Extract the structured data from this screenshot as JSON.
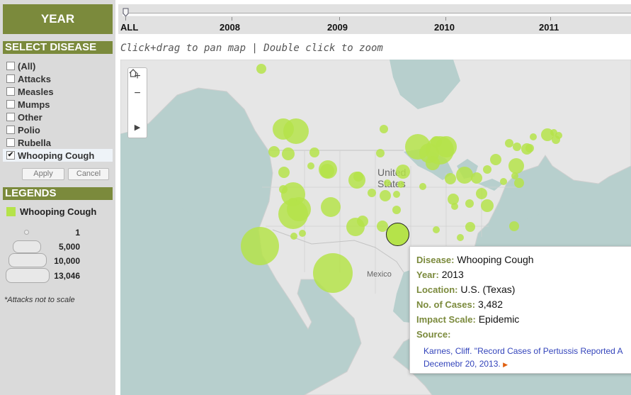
{
  "sidebar": {
    "year_title": "YEAR",
    "select_title": "SELECT DISEASE",
    "diseases": [
      {
        "label": "(All)",
        "checked": false
      },
      {
        "label": "Attacks",
        "checked": false
      },
      {
        "label": "Measles",
        "checked": false
      },
      {
        "label": "Mumps",
        "checked": false
      },
      {
        "label": "Other",
        "checked": false
      },
      {
        "label": "Polio",
        "checked": false
      },
      {
        "label": "Rubella",
        "checked": false
      },
      {
        "label": "Whooping Cough",
        "checked": true
      }
    ],
    "apply_label": "Apply",
    "cancel_label": "Cancel",
    "legends_title": "LEGENDS",
    "legend_series": "Whooping Cough",
    "legend_color": "#b5e34a",
    "size_scale": [
      "1",
      "5,000",
      "10,000",
      "13,046"
    ],
    "note": "*Attacks not to scale"
  },
  "timeline": {
    "labels": [
      "ALL",
      "2008",
      "2009",
      "2010",
      "2011"
    ]
  },
  "hint": "Click+drag to pan map | Double click to zoom",
  "map": {
    "labels": {
      "us": "United States",
      "us_line1": "United",
      "us_line2": "States",
      "mexico": "Mexico"
    },
    "zoom_controls": [
      "+",
      "−",
      "home",
      "▶"
    ],
    "bubble_color": "#b5e34a"
  },
  "tooltip": {
    "disease_key": "Disease:",
    "disease": "Whooping Cough",
    "year_key": "Year:",
    "year": "2013",
    "location_key": "Location:",
    "location": "U.S. (Texas)",
    "cases_key": "No. of Cases:",
    "cases": "3,482",
    "impact_key": "Impact Scale:",
    "impact": "Epidemic",
    "source_key": "Source:",
    "source_line1": "Karnes, Cliff. \"Record Cases of Pertussis Reported A",
    "source_line2": "Decemebr 20, 2013."
  }
}
